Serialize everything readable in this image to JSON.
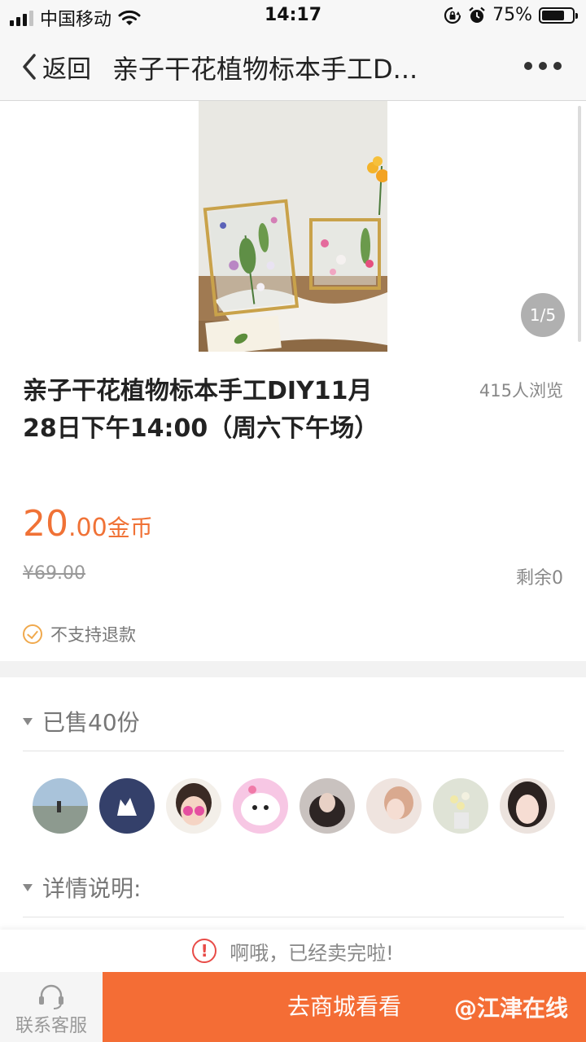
{
  "status_bar": {
    "carrier": "中国移动",
    "time": "14:17",
    "battery": "75%",
    "battery_level": 0.75
  },
  "nav": {
    "back_label": "返回",
    "title": "亲子干花植物标本手工D..."
  },
  "gallery": {
    "counter": "1/5"
  },
  "product": {
    "title": "亲子干花植物标本手工DIY11月28日下午14:00（周六下午场）",
    "views": "415人浏览",
    "price_int": "20",
    "price_dec": ".00",
    "price_unit": "金币",
    "original_price": "¥69.00",
    "remaining": "剩余0",
    "refund_policy": "不支持退款"
  },
  "sold": {
    "label": "已售40份",
    "avatar_count": 8
  },
  "details": {
    "label": "详情说明:"
  },
  "notice": {
    "icon": "!",
    "text": "啊哦，已经卖完啦!"
  },
  "bottom_bar": {
    "support_label": "联系客服",
    "shop_label": "去商城看看",
    "watermark": "@江津在线"
  },
  "colors": {
    "accent": "#f46d35",
    "price": "#f07236",
    "warning": "#e84b47"
  }
}
